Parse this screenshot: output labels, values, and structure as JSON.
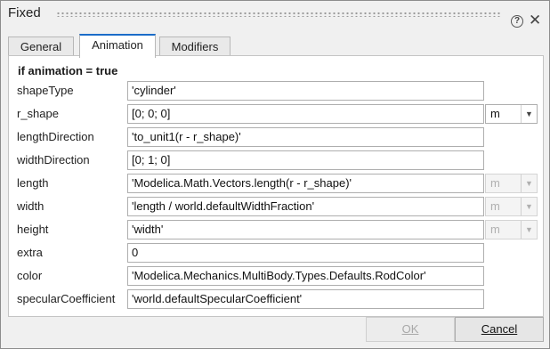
{
  "window": {
    "title": "Fixed"
  },
  "tabs": [
    {
      "label": "General",
      "active": false
    },
    {
      "label": "Animation",
      "active": true
    },
    {
      "label": "Modifiers",
      "active": false
    }
  ],
  "section": {
    "heading": "if animation = true"
  },
  "params": [
    {
      "label": "shapeType",
      "value": "'cylinder'"
    },
    {
      "label": "r_shape",
      "value": "[0; 0; 0]",
      "unit": "m",
      "unit_enabled": true
    },
    {
      "label": "lengthDirection",
      "value": "'to_unit1(r - r_shape)'"
    },
    {
      "label": "widthDirection",
      "value": "[0; 1; 0]"
    },
    {
      "label": "length",
      "value": "'Modelica.Math.Vectors.length(r - r_shape)'",
      "unit": "m",
      "unit_enabled": false
    },
    {
      "label": "width",
      "value": "'length / world.defaultWidthFraction'",
      "unit": "m",
      "unit_enabled": false
    },
    {
      "label": "height",
      "value": "'width'",
      "unit": "m",
      "unit_enabled": false
    },
    {
      "label": "extra",
      "value": "0"
    },
    {
      "label": "color",
      "value": "'Modelica.Mechanics.MultiBody.Types.Defaults.RodColor'"
    },
    {
      "label": "specularCoefficient",
      "value": "'world.defaultSpecularCoefficient'"
    }
  ],
  "buttons": {
    "ok": {
      "label": "OK",
      "enabled": false
    },
    "cancel": {
      "label": "Cancel",
      "enabled": true
    }
  },
  "icons": {
    "help": "help-icon",
    "close": "close-icon",
    "dropdown": "chevron-down-icon"
  },
  "colors": {
    "accent": "#1a6cc8",
    "disabled_text": "#a8a8a8"
  }
}
